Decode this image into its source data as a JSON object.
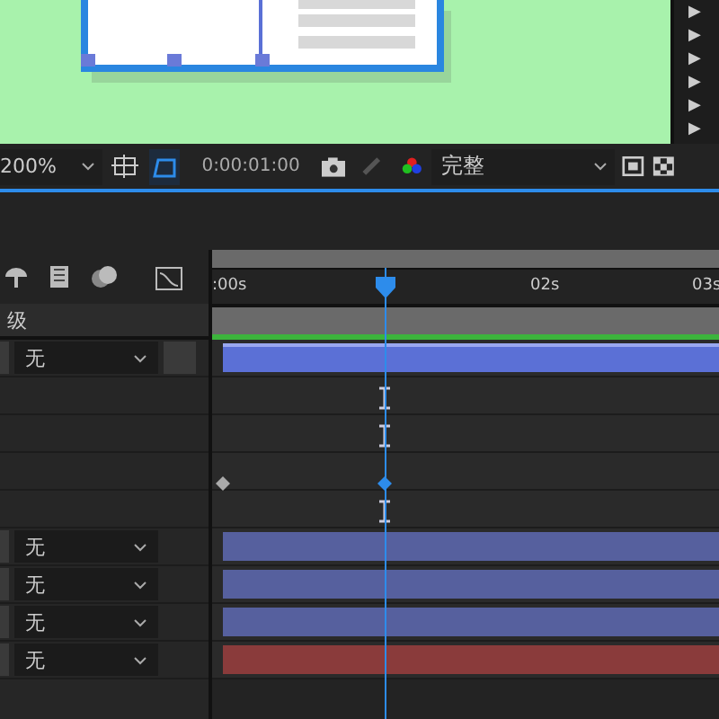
{
  "viewer": {
    "panel_items": [
      {
        "label": "▶"
      },
      {
        "label": "▶"
      },
      {
        "label": "▶"
      },
      {
        "label": "▶"
      },
      {
        "label": "▶"
      },
      {
        "label": "▶"
      }
    ]
  },
  "viewer_toolbar": {
    "zoom": "200%",
    "timecode": "0:00:01:00",
    "resolution": "完整",
    "mask_toggle_on": true
  },
  "timeline": {
    "ruler": [
      {
        "label": ":00s"
      },
      {
        "label": "02s"
      },
      {
        "label": "03s"
      }
    ],
    "column_header": "级",
    "rows": [
      {
        "kind": "layer",
        "parent": "无",
        "color": "#5b70d6",
        "selected": true
      },
      {
        "kind": "property",
        "keyframes": [
          {
            "at_playhead": true,
            "kind": "hold",
            "selected": false
          }
        ]
      },
      {
        "kind": "property",
        "keyframes": [
          {
            "at_playhead": true,
            "kind": "hold",
            "selected": false
          }
        ]
      },
      {
        "kind": "property",
        "keyframes": [
          {
            "at_playhead": false,
            "kind": "diamond",
            "selected": false
          },
          {
            "at_playhead": true,
            "kind": "diamond",
            "selected": true
          }
        ]
      },
      {
        "kind": "property",
        "keyframes": [
          {
            "at_playhead": true,
            "kind": "hold",
            "selected": false
          }
        ]
      },
      {
        "kind": "layer",
        "parent": "无",
        "color": "#56609e",
        "selected": false
      },
      {
        "kind": "layer",
        "parent": "无",
        "color": "#56609e",
        "selected": false
      },
      {
        "kind": "layer",
        "parent": "无",
        "color": "#56609e",
        "selected": false
      },
      {
        "kind": "layer",
        "parent": "无",
        "color": "#8a3b3b",
        "selected": false
      }
    ]
  }
}
